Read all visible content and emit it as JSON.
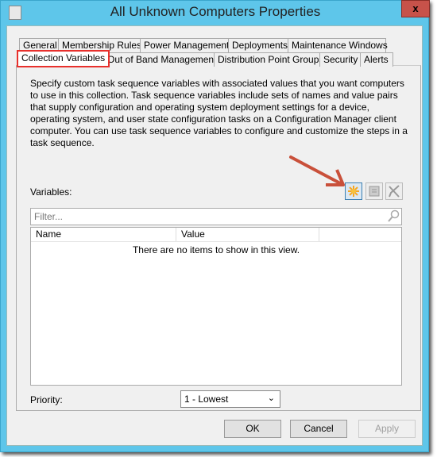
{
  "window": {
    "title": "All Unknown Computers Properties",
    "close_label": "x"
  },
  "tabs_row1": [
    "General",
    "Membership Rules",
    "Power Management",
    "Deployments",
    "Maintenance Windows"
  ],
  "tabs_row2": [
    "Collection Variables",
    "Out of Band Management",
    "Distribution Point Groups",
    "Security",
    "Alerts"
  ],
  "selected_tab": "Collection Variables",
  "description": "Specify custom task sequence variables with associated values that you want computers to use in this collection. Task sequence variables include sets of names and value pairs that supply configuration and operating system deployment settings for a device, operating system, and user state configuration tasks on a Configuration Manager client computer. You can use task sequence variables to configure and customize the steps in a task sequence.",
  "variables": {
    "label": "Variables:",
    "filter_placeholder": "Filter...",
    "columns": [
      "Name",
      "Value"
    ],
    "empty_text": "There are no items to show in this view.",
    "toolbar": [
      {
        "icon": "new-star-icon",
        "color": "#f5a623"
      },
      {
        "icon": "properties-icon"
      },
      {
        "icon": "delete-x-icon"
      }
    ]
  },
  "priority": {
    "label": "Priority:",
    "value": "1 - Lowest"
  },
  "buttons": {
    "ok": "OK",
    "cancel": "Cancel",
    "apply": "Apply"
  },
  "annotation": {
    "arrow_color": "#c9503a",
    "highlight_color": "#e8302c"
  }
}
